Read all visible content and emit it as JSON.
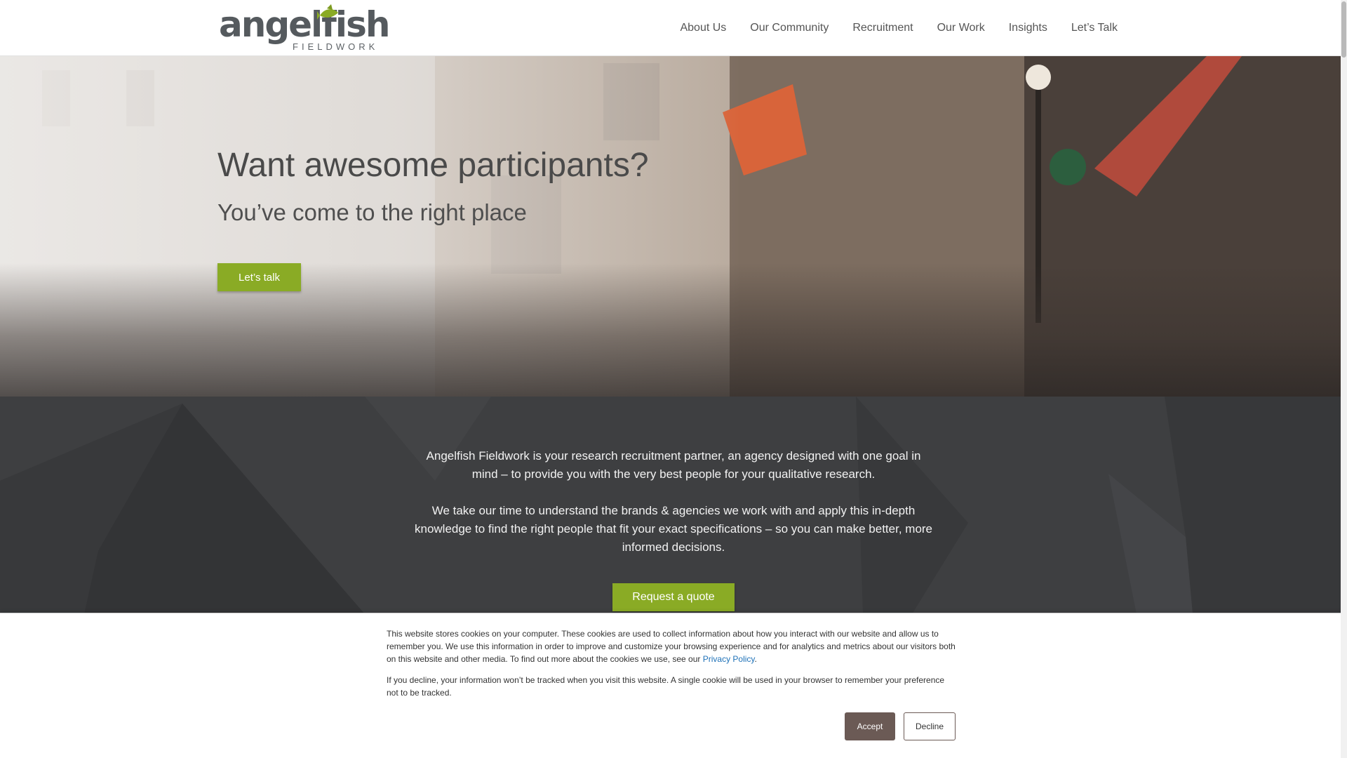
{
  "brand": {
    "name": "angelfish",
    "tagline": "FIELDWORK",
    "colors": {
      "green": "#8aab25",
      "dark": "#3e3f41",
      "accept": "#6b5a55",
      "link": "#1f72b8"
    }
  },
  "nav": {
    "items": [
      {
        "label": "About Us"
      },
      {
        "label": "Our Community"
      },
      {
        "label": "Recruitment"
      },
      {
        "label": "Our Work"
      },
      {
        "label": "Insights"
      },
      {
        "label": "Let’s Talk"
      }
    ]
  },
  "hero": {
    "title": "Want awesome participants?",
    "subtitle": "You’ve come to the right place",
    "cta_label": "Let’s talk"
  },
  "intro": {
    "paragraph1": "Angelfish Fieldwork is your research recruitment partner, an agency designed with one goal in mind – to provide you with the very best people for your qualitative research.",
    "paragraph2": "We take our time to understand the brands & agencies we work with and apply this in-depth knowledge to find the right people that fit your exact specifications – so you can make better, more informed decisions.",
    "cta_label": "Request a quote"
  },
  "cookie": {
    "text1": "This website stores cookies on your computer. These cookies are used to collect information about how you interact with our website and allow us to remember you. We use this information in order to improve and customize your browsing experience and for analytics and metrics about our visitors both on this website and other media. To find out more about the cookies we use, see our",
    "link_label": "Privacy Policy",
    "text1_end": ".",
    "text2": "If you decline, your information won’t be tracked when you visit this website. A single cookie will be used in your browser to remember your preference not to be tracked.",
    "accept_label": "Accept",
    "decline_label": "Decline"
  }
}
